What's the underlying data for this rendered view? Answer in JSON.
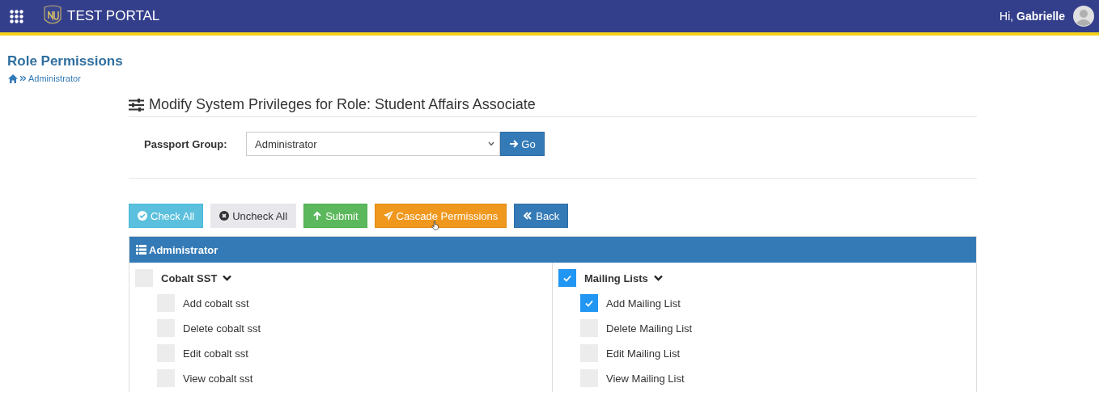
{
  "header": {
    "title": "TEST PORTAL",
    "greeting": "Hi, **Gabrielle**"
  },
  "page": {
    "title": "Role Permissions",
    "breadcrumb": "Administrator"
  },
  "form": {
    "heading": "Modify System Privileges for Role: Student Affairs Associate",
    "label": "Passport Group:",
    "value": "Administrator",
    "go": "Go"
  },
  "buttons": [
    {
      "kind": "check",
      "label": "Check All"
    },
    {
      "kind": "uncheck",
      "label": "Uncheck All"
    },
    {
      "kind": "submit",
      "label": "Submit"
    },
    {
      "kind": "cascade",
      "label": "Cascade Permissions"
    },
    {
      "kind": "back",
      "label": "Back"
    }
  ],
  "panel": {
    "title": "Administrator",
    "groups": [
      {
        "label": "Cobalt SST",
        "checked": false,
        "children": [
          {
            "label": "Add cobalt sst",
            "checked": false
          },
          {
            "label": "Delete cobalt sst",
            "checked": false
          },
          {
            "label": "Edit cobalt sst",
            "checked": false
          },
          {
            "label": "View cobalt sst",
            "checked": false
          }
        ]
      },
      {
        "label": "Mailing Lists",
        "checked": true,
        "children": [
          {
            "label": "Add Mailing List",
            "checked": true
          },
          {
            "label": "Delete Mailing List",
            "checked": false
          },
          {
            "label": "Edit Mailing List",
            "checked": false
          },
          {
            "label": "View Mailing List",
            "checked": false
          }
        ]
      }
    ]
  }
}
